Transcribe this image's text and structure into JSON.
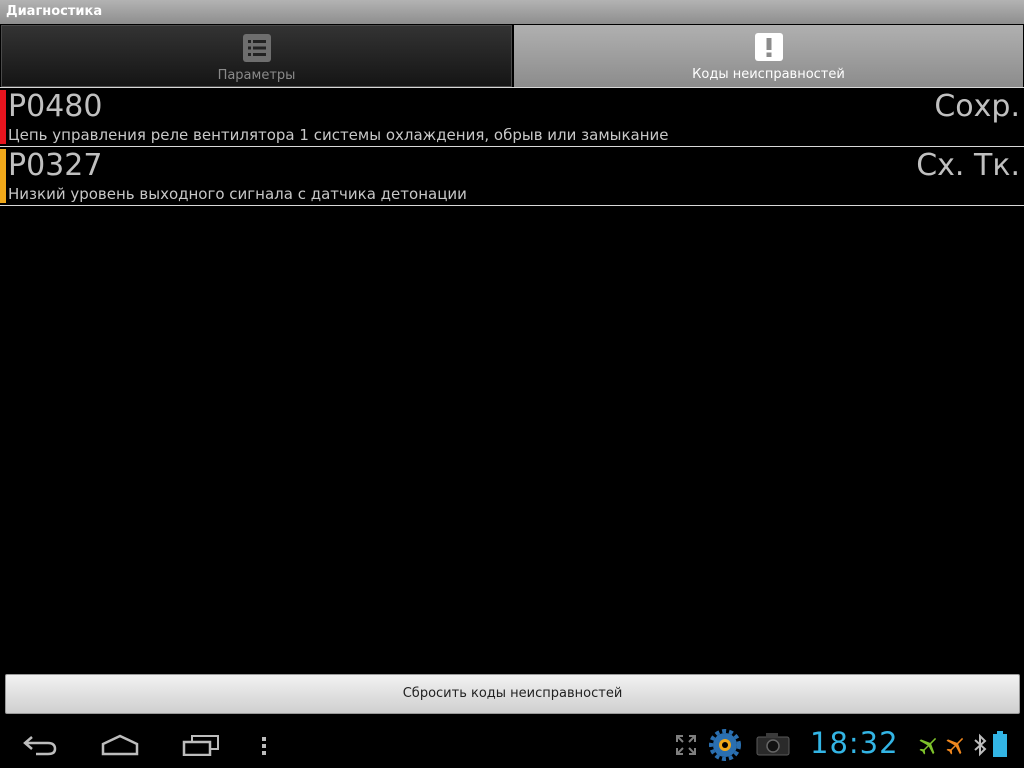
{
  "window": {
    "title": "Диагностика"
  },
  "tabs": [
    {
      "label": "Параметры",
      "icon": "list-icon",
      "selected": false
    },
    {
      "label": "Коды неисправностей",
      "icon": "exclamation-icon",
      "selected": true
    }
  ],
  "faults": [
    {
      "code": "P0480",
      "status": "Сохр.",
      "description": "Цепь управления реле вентилятора 1 системы охлаждения, обрыв или замыкание",
      "color": "#e8141e"
    },
    {
      "code": "P0327",
      "status": "Сх. Тк.",
      "description": "Низкий уровень выходного сигнала с датчика детонации",
      "color": "#f0a81a"
    }
  ],
  "reset_button": {
    "label": "Сбросить коды неисправностей"
  },
  "status_bar": {
    "time": "18:32",
    "icons": [
      "fullscreen-icon",
      "gear-app-icon",
      "camera-icon",
      "airplane-icon",
      "airplane-icon",
      "bluetooth-icon",
      "battery-icon"
    ]
  },
  "nav": {
    "icons": [
      "back-icon",
      "home-icon",
      "recent-apps-icon",
      "menu-icon"
    ]
  },
  "colors": {
    "accent_clock": "#33b5e5",
    "tray_green": "#7ec32b",
    "tray_orange": "#f0871e"
  }
}
